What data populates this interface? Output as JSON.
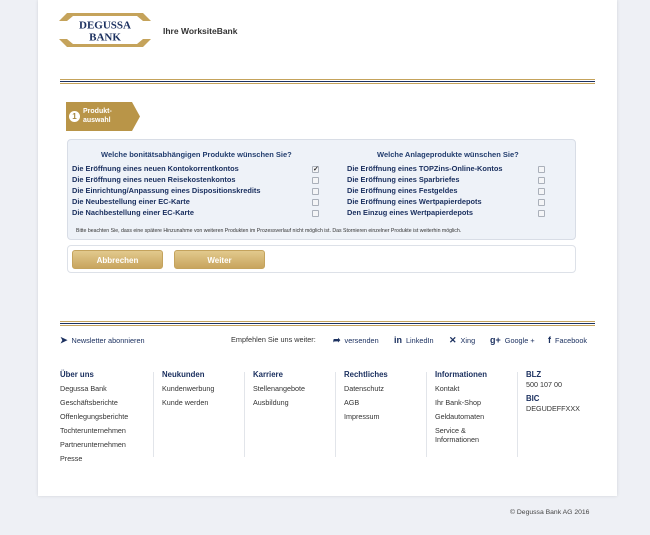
{
  "brand": {
    "logo_top": "DEGUSSA",
    "logo_bottom": "BANK",
    "subtitle": "Ihre WorksiteBank",
    "gold": "#c5a35b",
    "navy": "#1c3160"
  },
  "step": {
    "number": "1",
    "label_line1": "Produkt-",
    "label_line2": "auswahl"
  },
  "products": {
    "left_heading": "Welche bonitätsabhängigen Produkte wünschen Sie?",
    "right_heading": "Welche Anlageprodukte wünschen Sie?",
    "left_items": [
      {
        "label": "Die Eröffnung eines neuen Kontokorrentkontos",
        "checked": "✓"
      },
      {
        "label": "Die Eröffnung eines neuen Reisekostenkontos",
        "checked": ""
      },
      {
        "label": "Die Einrichtung/Anpassung eines Dispositionskredits",
        "checked": ""
      },
      {
        "label": "Die Neubestellung einer EC-Karte",
        "checked": ""
      },
      {
        "label": "Die Nachbestellung einer EC-Karte",
        "checked": ""
      }
    ],
    "right_items": [
      {
        "label": "Die Eröffnung eines TOPZins-Online-Kontos",
        "checked": ""
      },
      {
        "label": "Die Eröffnung eines Sparbriefes",
        "checked": ""
      },
      {
        "label": "Die Eröffnung eines Festgeldes",
        "checked": ""
      },
      {
        "label": "Die Eröffnung eines Wertpapierdepots",
        "checked": ""
      },
      {
        "label": "Den Einzug eines Wertpapierdepots",
        "checked": ""
      }
    ],
    "note": "Bitte beachten Sie, dass eine spätere Hinzunahme von weiteren Produkten im Prozessverlauf nicht möglich ist. Das Stornieren einzelner Produkte ist weiterhin möglich."
  },
  "buttons": {
    "cancel": "Abbrechen",
    "next": "Weiter"
  },
  "footer": {
    "newsletter": "Newsletter abonnieren",
    "recommend": "Empfehlen Sie uns weiter:",
    "send": "versenden",
    "linkedin": "LinkedIn",
    "xing": "Xing",
    "googleplus": "Google +",
    "facebook": "Facebook",
    "columns": [
      {
        "heading": "Über uns",
        "items": [
          "Degussa Bank",
          "Geschäftsberichte",
          "Offenlegungsberichte",
          "Tochterunternehmen",
          "Partnerunternehmen",
          "Presse"
        ]
      },
      {
        "heading": "Neukunden",
        "items": [
          "Kundenwerbung",
          "Kunde werden"
        ]
      },
      {
        "heading": "Karriere",
        "items": [
          "Stellenangebote",
          "Ausbildung"
        ]
      },
      {
        "heading": "Rechtliches",
        "items": [
          "Datenschutz",
          "AGB",
          "Impressum"
        ]
      },
      {
        "heading": "Informationen",
        "items": [
          "Kontakt",
          "Ihr Bank-Shop",
          "Geldautomaten",
          "Service &",
          "Informationen"
        ]
      }
    ],
    "blz_label": "BLZ",
    "blz_value": "500 107 00",
    "bic_label": "BIC",
    "bic_value": "DEGUDEFFXXX",
    "copyright": "© Degussa Bank AG 2016"
  }
}
